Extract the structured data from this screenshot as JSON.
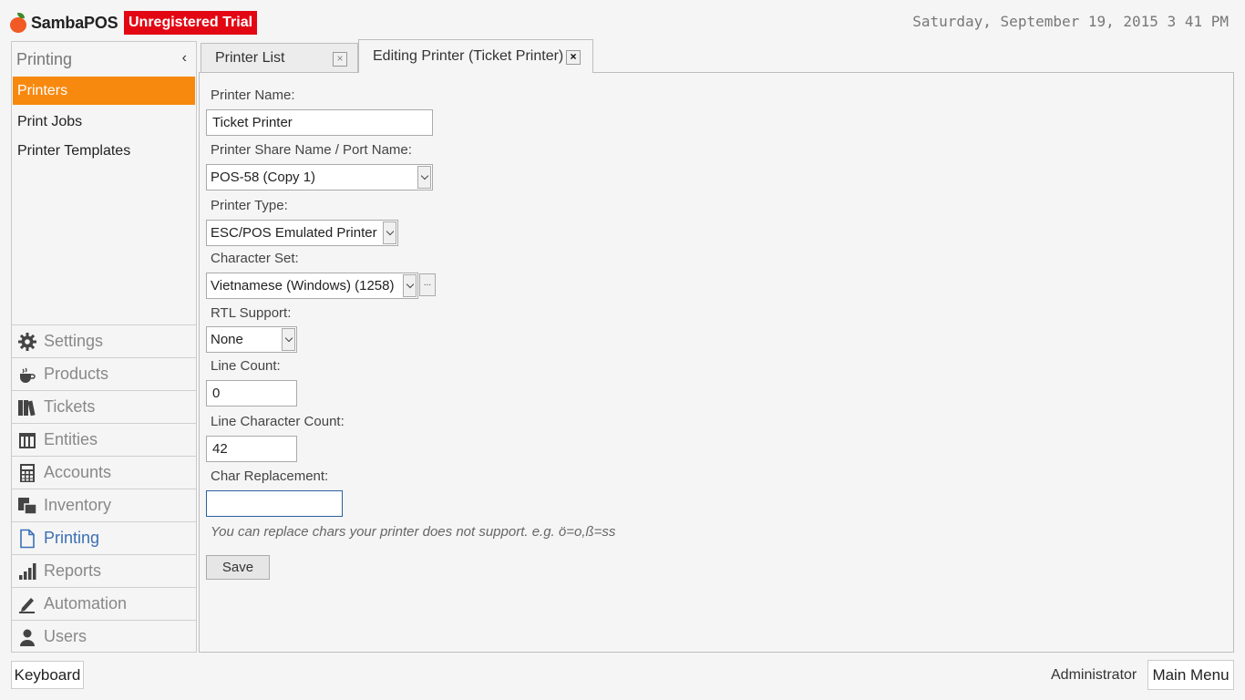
{
  "app": {
    "brand": "SambaPOS",
    "trial_badge": "Unregistered Trial",
    "datetime": "Saturday, September 19, 2015 3 41 PM"
  },
  "sidebar": {
    "title": "Printing",
    "collapse_glyph": "‹",
    "sub_items": [
      {
        "label": "Printers",
        "active": true
      },
      {
        "label": "Print Jobs",
        "active": false
      },
      {
        "label": "Printer Templates",
        "active": false
      }
    ],
    "nav": [
      {
        "label": "Settings",
        "icon": "gear-icon"
      },
      {
        "label": "Products",
        "icon": "coffee-cup-icon"
      },
      {
        "label": "Tickets",
        "icon": "books-icon"
      },
      {
        "label": "Entities",
        "icon": "table-grid-icon"
      },
      {
        "label": "Accounts",
        "icon": "calculator-icon"
      },
      {
        "label": "Inventory",
        "icon": "boxes-icon"
      },
      {
        "label": "Printing",
        "icon": "document-icon",
        "active": true
      },
      {
        "label": "Reports",
        "icon": "bar-chart-icon"
      },
      {
        "label": "Automation",
        "icon": "pencil-icon"
      },
      {
        "label": "Users",
        "icon": "user-icon"
      }
    ]
  },
  "tabs": [
    {
      "label": "Printer List",
      "close": "×"
    },
    {
      "label": "Editing Printer (Ticket Printer)",
      "close": "×"
    }
  ],
  "form": {
    "printer_name_label": "Printer Name:",
    "printer_name_value": "Ticket Printer",
    "share_name_label": "Printer Share Name / Port Name:",
    "share_name_value": "POS-58 (Copy 1)",
    "printer_type_label": "Printer Type:",
    "printer_type_value": "ESC/POS Emulated Printer",
    "charset_label": "Character Set:",
    "charset_value": "Vietnamese (Windows) (1258)",
    "charset_more": "...",
    "rtl_label": "RTL Support:",
    "rtl_value": "None",
    "line_count_label": "Line Count:",
    "line_count_value": "0",
    "line_char_count_label": "Line Character Count:",
    "line_char_count_value": "42",
    "char_replacement_label": "Char Replacement:",
    "char_replacement_value": "",
    "hint": "You can replace chars your printer does not support. e.g. ö=o,ß=ss",
    "save_label": "Save"
  },
  "footer": {
    "keyboard_label": "Keyboard",
    "user": "Administrator",
    "main_menu_label": "Main Menu"
  },
  "colors": {
    "accent_orange": "#f7890f",
    "trial_red": "#e30613",
    "active_nav_blue": "#3b6fb5"
  }
}
